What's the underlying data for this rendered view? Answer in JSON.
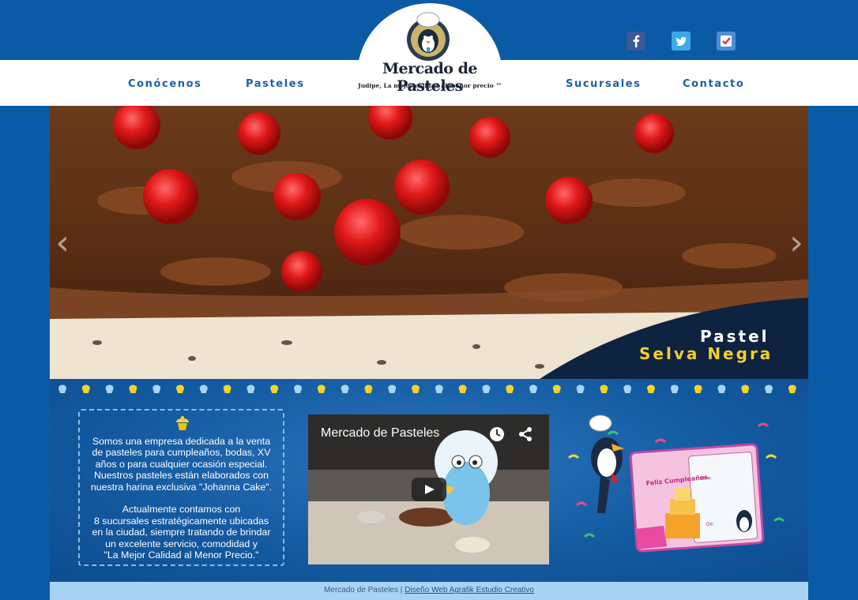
{
  "header": {
    "nav": [
      {
        "label": "Conócenos"
      },
      {
        "label": "Pasteles"
      },
      {
        "label": "Sucursales"
      },
      {
        "label": "Contacto"
      }
    ],
    "logo": {
      "name": "Mercado de Pasteles",
      "tagline": "Judipe, La mejor calidad al menor precio ™"
    },
    "social": [
      {
        "icon": "facebook-icon",
        "color": "#3b5998"
      },
      {
        "icon": "twitter-icon",
        "color": "#3fa9e6"
      },
      {
        "icon": "foursquare-icon",
        "color": "#4b8fd6"
      }
    ]
  },
  "slider": {
    "caption_line1": "Pastel",
    "caption_line2": "Selva Negra",
    "prev_arrow": "‹",
    "next_arrow": "›"
  },
  "about": {
    "text": "Somos una empresa dedicada a la venta\nde pasteles para cumpleaños, bodas, XV\naños o para cualquier ocasión especial.\nNuestros pasteles están elaborados con\nnuestra harina exclusiva \"Johanna Cake\".\n\nActualmente contamos con\n8 sucursales estratégicamente ubicadas\nen la ciudad, siempre tratando de brindar\nun excelente servicio, comodidad y\n\"La Mejor Calidad al Menor Precio.\""
  },
  "video": {
    "title": "Mercado de Pasteles"
  },
  "promo": {
    "card_text": "Feliz Cumpleaños",
    "para": "Para:",
    "de": "De:"
  },
  "footer": {
    "site": "Mercado de Pasteles",
    "separator": " | ",
    "credit": "Diseño Web Agrafik Estudio Creativo"
  },
  "colors": {
    "accent_blue": "#0b5aa5",
    "nav_text": "#1b5ea8",
    "caption_yellow": "#f7cf2a",
    "footer_bg": "#a8d3f5"
  }
}
